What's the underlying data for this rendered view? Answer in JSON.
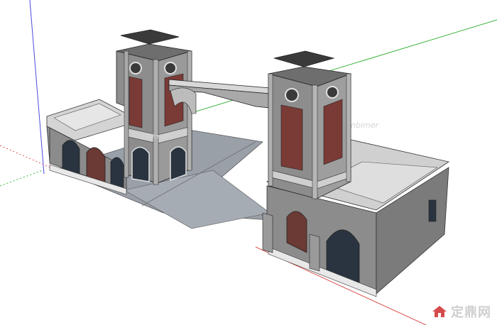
{
  "app": {
    "kind": "sketchup-viewport",
    "background_color": "#ffffff"
  },
  "axes": {
    "red_color": "#d9534f",
    "green_color": "#3cb33c",
    "blue_color": "#4a4adf"
  },
  "model": {
    "subject": "gate building with two towers and a connecting bridge",
    "wall_color": "#8f8f8f",
    "roof_color": "#d0d0d0",
    "brick_color": "#7a3a35",
    "glass_color": "#2a3440",
    "ground_color": "#9aa0a8"
  },
  "watermark": {
    "text": "定鼎网",
    "icon": "house-logo-icon",
    "color": "#c9c9c9"
  }
}
